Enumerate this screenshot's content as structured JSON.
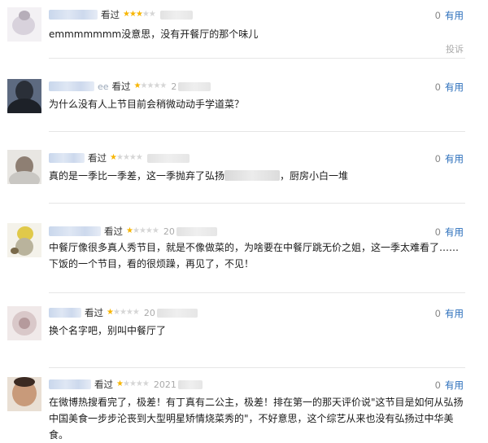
{
  "watched_label": "看过",
  "useful_label": "有用",
  "report_label": "投诉",
  "comments": [
    {
      "name_suffix": "",
      "stars": 3,
      "date": "",
      "useful_count": "0",
      "text": "emmmmmmm没意思，没有开餐厅的那个味儿"
    },
    {
      "name_suffix": "ee",
      "stars": 1,
      "date": "2",
      "useful_count": "0",
      "text": "为什么没有人上节目前会稍微动动手学道菜？"
    },
    {
      "name_suffix": "",
      "stars": 1,
      "date": "",
      "useful_count": "0",
      "text_a": "真的是一季比一季差，这一季抛弃了弘扬",
      "text_b": "，厨房小白一堆"
    },
    {
      "name_suffix": "",
      "stars": 1,
      "date": "20",
      "useful_count": "0",
      "text": "中餐厅像很多真人秀节目，就是不像做菜的，为啥要在中餐厅跳无价之姐，这一季太难看了……下饭的一个节目，看的很烦躁，再见了，不见！"
    },
    {
      "name_suffix": "",
      "stars": 1,
      "date": "20",
      "useful_count": "0",
      "text": "换个名字吧，别叫中餐厅了"
    },
    {
      "name_suffix": "",
      "stars": 1,
      "date": "2021",
      "useful_count": "0",
      "text": "在微博热搜看完了，极差！有丁真有二公主，极差！排在第一的那天评价说\"这节目是如何从弘扬中国美食一步步沦丧到大型明星矫情烧菜秀的\"，不好意思，这个综艺从来也没有弘扬过中华美食。"
    }
  ]
}
